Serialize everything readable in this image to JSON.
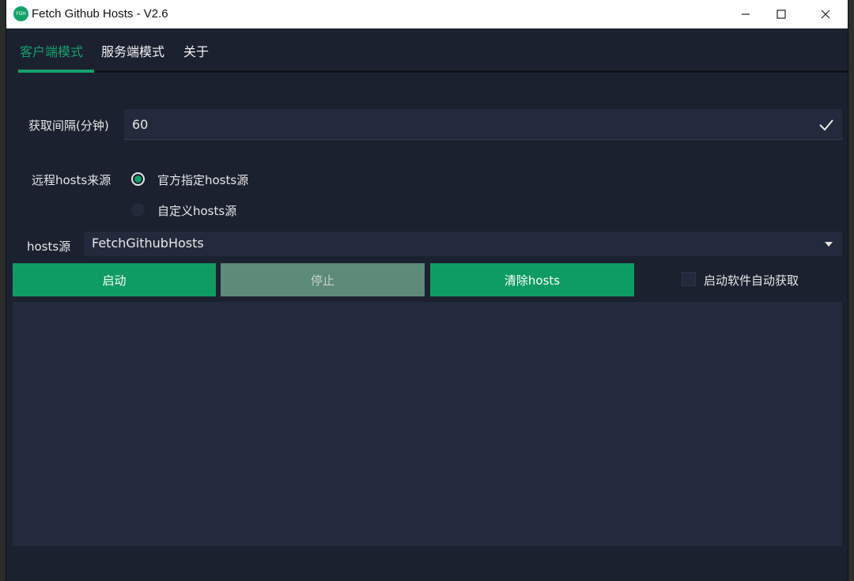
{
  "window": {
    "title": "Fetch Github Hosts - V2.6",
    "logo_text": "FGH",
    "controls": [
      "minimize-icon",
      "maximize-icon",
      "close-icon"
    ]
  },
  "tabs": [
    {
      "label": "客户端模式",
      "active": true
    },
    {
      "label": "服务端模式",
      "active": false
    },
    {
      "label": "关于",
      "active": false
    }
  ],
  "interval": {
    "label": "获取间隔(分钟)",
    "value": "60",
    "confirm_icon": "check-icon"
  },
  "source": {
    "label": "远程hosts来源",
    "options": [
      {
        "label": "官方指定hosts源",
        "checked": true
      },
      {
        "label": "自定义hosts源",
        "checked": false
      }
    ]
  },
  "hosts_source": {
    "label": "hosts源",
    "value": "FetchGithubHosts",
    "dropdown_icon": "caret-down-icon"
  },
  "actions": {
    "start": "启动",
    "stop": "停止",
    "clear": "清除hosts",
    "autostart_label": "启动软件自动获取",
    "autostart_checked": false
  },
  "colors": {
    "accent": "#12a06b",
    "background": "#1c2130",
    "field": "#232a3b",
    "disabled_button": "#5e8a78"
  }
}
